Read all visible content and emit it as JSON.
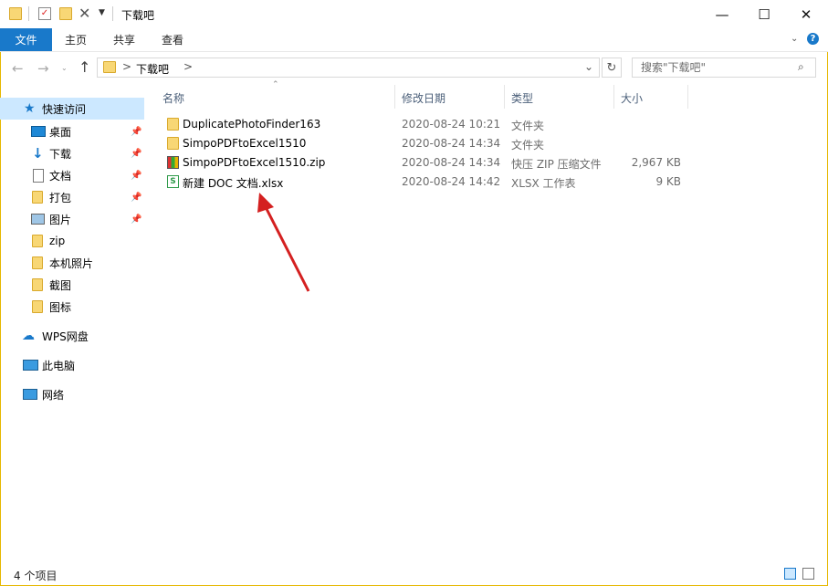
{
  "window": {
    "title": "下载吧"
  },
  "ribbon": {
    "tabs": [
      "文件",
      "主页",
      "共享",
      "查看"
    ]
  },
  "address": {
    "current": "下载吧",
    "separator": ">"
  },
  "search": {
    "placeholder": "搜索\"下载吧\""
  },
  "nav": {
    "quick_access": "快速访问",
    "items": [
      {
        "label": "桌面",
        "icon": "desktop-icon",
        "pinned": true
      },
      {
        "label": "下载",
        "icon": "download-arrow-icon",
        "pinned": true
      },
      {
        "label": "文档",
        "icon": "document-icon",
        "pinned": true
      },
      {
        "label": "打包",
        "icon": "folder-icon",
        "pinned": true
      },
      {
        "label": "图片",
        "icon": "pictures-icon",
        "pinned": true
      },
      {
        "label": "zip",
        "icon": "folder-icon",
        "pinned": false
      },
      {
        "label": "本机照片",
        "icon": "folder-icon",
        "pinned": false
      },
      {
        "label": "截图",
        "icon": "folder-icon",
        "pinned": false
      },
      {
        "label": "图标",
        "icon": "folder-icon",
        "pinned": false
      }
    ],
    "wps": "WPS网盘",
    "pc": "此电脑",
    "network": "网络"
  },
  "columns": {
    "name": "名称",
    "date": "修改日期",
    "type": "类型",
    "size": "大小"
  },
  "files": [
    {
      "name": "DuplicatePhotoFinder163",
      "date": "2020-08-24 10:21",
      "type": "文件夹",
      "size": "",
      "icon": "folder-icon"
    },
    {
      "name": "SimpoPDFtoExcel1510",
      "date": "2020-08-24 14:34",
      "type": "文件夹",
      "size": "",
      "icon": "folder-icon"
    },
    {
      "name": "SimpoPDFtoExcel1510.zip",
      "date": "2020-08-24 14:34",
      "type": "快压 ZIP 压缩文件",
      "size": "2,967 KB",
      "icon": "zip-archive-icon"
    },
    {
      "name": "新建 DOC 文档.xlsx",
      "date": "2020-08-24 14:42",
      "type": "XLSX 工作表",
      "size": "9 KB",
      "icon": "xlsx-file-icon"
    }
  ],
  "status": {
    "count": "4 个项目"
  },
  "colors": {
    "accent": "#1979ca",
    "folder": "#f8d775",
    "arrow": "#d42020"
  }
}
